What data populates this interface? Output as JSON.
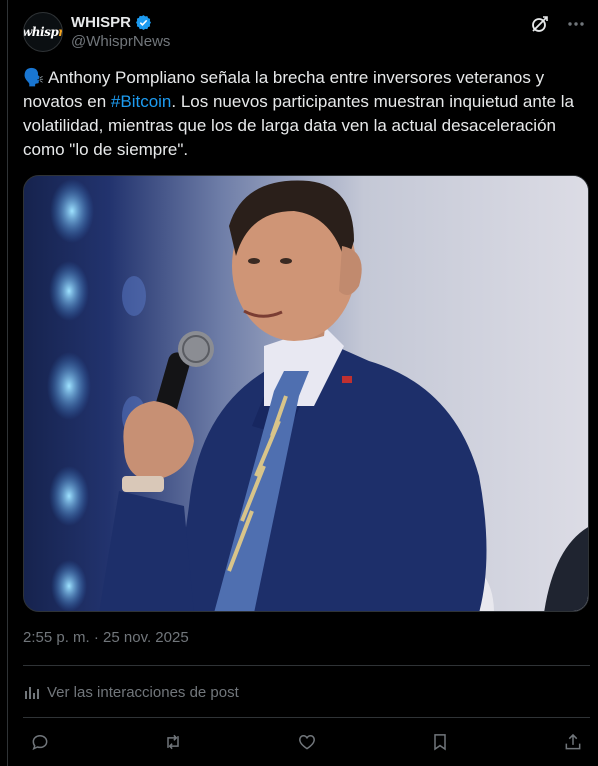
{
  "account": {
    "display_name": "WHISPR",
    "handle": "@WhisprNews",
    "avatar_text": "whispr",
    "avatar_text_accent": "r",
    "verified_color": "#1d9bf0"
  },
  "post": {
    "emoji": "🗣️",
    "text_part1": " Anthony Pompliano señala la brecha entre inversores veteranos y novatos en ",
    "hashtag": "#Bitcoin",
    "text_part2": ". Los nuevos participantes muestran inquietud ante la volatilidad, mientras que los de larga data ven la actual desaceleración como \"lo de siempre\".",
    "timestamp_time": "2:55 p. m.",
    "separator": " · ",
    "timestamp_date": "25 nov. 2025"
  },
  "analytics": {
    "label": "Ver las interacciones de post",
    "icon": "bar-chart-icon"
  },
  "actions": [
    {
      "name": "reply",
      "icon": "comment-icon"
    },
    {
      "name": "repost",
      "icon": "repost-icon"
    },
    {
      "name": "like",
      "icon": "heart-icon"
    },
    {
      "name": "bookmark",
      "icon": "bookmark-icon"
    },
    {
      "name": "share",
      "icon": "share-icon"
    }
  ],
  "colors": {
    "background": "#000000",
    "text": "#e7e9ea",
    "muted": "#71767b",
    "link": "#1d9bf0",
    "border": "#2f3336"
  }
}
